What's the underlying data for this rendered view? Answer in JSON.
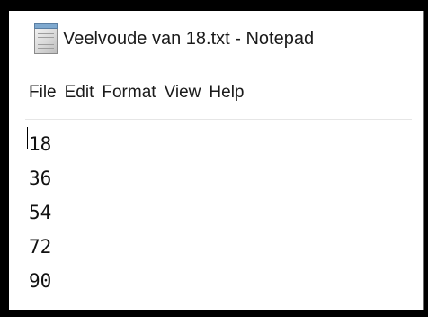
{
  "window": {
    "title": "Veelvoude van 18.txt - Notepad",
    "icon": "notepad-icon"
  },
  "menu": {
    "items": [
      "File",
      "Edit",
      "Format",
      "View",
      "Help"
    ]
  },
  "editor": {
    "lines": [
      "18",
      "36",
      "54",
      "72",
      "90"
    ]
  },
  "colors": {
    "background": "#ffffff",
    "text": "#111111"
  }
}
